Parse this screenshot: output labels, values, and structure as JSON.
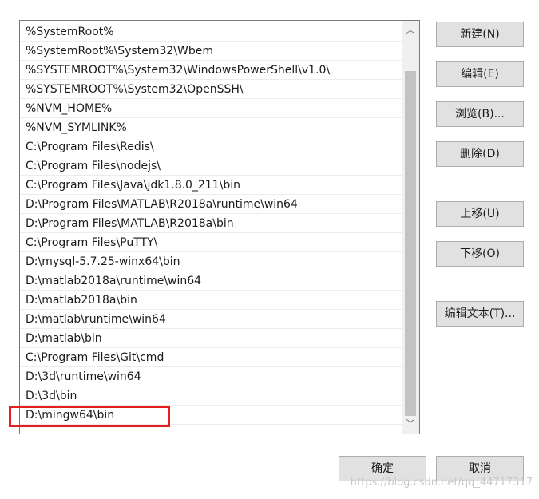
{
  "path_list": {
    "items": [
      "%SystemRoot%",
      "%SystemRoot%\\System32\\Wbem",
      "%SYSTEMROOT%\\System32\\WindowsPowerShell\\v1.0\\",
      "%SYSTEMROOT%\\System32\\OpenSSH\\",
      "%NVM_HOME%",
      "%NVM_SYMLINK%",
      "C:\\Program Files\\Redis\\",
      "C:\\Program Files\\nodejs\\",
      "C:\\Program Files\\Java\\jdk1.8.0_211\\bin",
      "D:\\Program Files\\MATLAB\\R2018a\\runtime\\win64",
      "D:\\Program Files\\MATLAB\\R2018a\\bin",
      "C:\\Program Files\\PuTTY\\",
      "D:\\mysql-5.7.25-winx64\\bin",
      "D:\\matlab2018a\\runtime\\win64",
      "D:\\matlab2018a\\bin",
      "D:\\matlab\\runtime\\win64",
      "D:\\matlab\\bin",
      "C:\\Program Files\\Git\\cmd",
      "D:\\3d\\runtime\\win64",
      "D:\\3d\\bin",
      "D:\\mingw64\\bin"
    ],
    "highlight_color": "#e81d1d"
  },
  "scrollbar": {
    "up_glyph": "︿",
    "down_glyph": "﹀"
  },
  "buttons": {
    "new": "新建(N)",
    "edit": "编辑(E)",
    "browse": "浏览(B)...",
    "delete": "删除(D)",
    "move_up": "上移(U)",
    "move_down": "下移(O)",
    "edit_text": "编辑文本(T)...",
    "ok": "确定",
    "cancel": "取消"
  },
  "watermark": "https://blog.csdn.net/qq_44717317"
}
